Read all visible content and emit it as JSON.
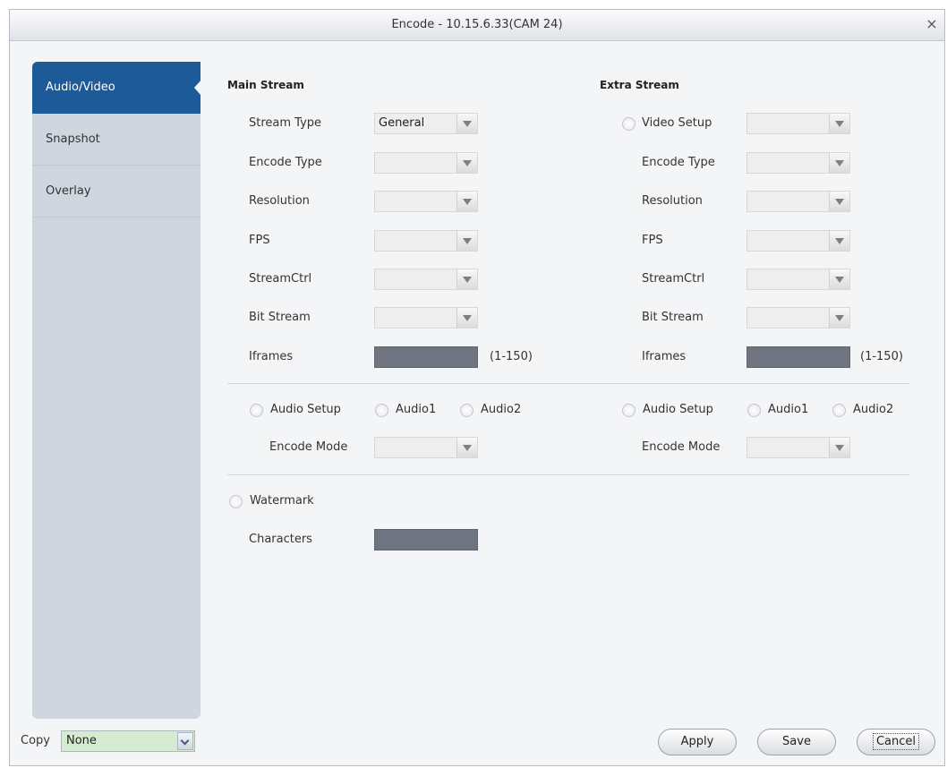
{
  "window": {
    "title": "Encode - 10.15.6.33(CAM 24)",
    "close_label": "×"
  },
  "sidebar": {
    "items": [
      {
        "label": "Audio/Video"
      },
      {
        "label": "Snapshot"
      },
      {
        "label": "Overlay"
      }
    ]
  },
  "main_stream": {
    "title": "Main Stream",
    "stream_type": {
      "label": "Stream Type",
      "value": "General"
    },
    "encode_type": {
      "label": "Encode Type",
      "value": ""
    },
    "resolution": {
      "label": "Resolution",
      "value": ""
    },
    "fps": {
      "label": "FPS",
      "value": ""
    },
    "stream_ctrl": {
      "label": "StreamCtrl",
      "value": ""
    },
    "bit_stream": {
      "label": "Bit Stream",
      "value": ""
    },
    "iframes": {
      "label": "Iframes",
      "range": "(1-150)"
    },
    "audio": {
      "setup": "Audio Setup",
      "audio1": "Audio1",
      "audio2": "Audio2",
      "encode_mode": {
        "label": "Encode Mode",
        "value": ""
      }
    }
  },
  "extra_stream": {
    "title": "Extra Stream",
    "video_setup": {
      "label": "Video Setup",
      "value": ""
    },
    "encode_type": {
      "label": "Encode Type",
      "value": ""
    },
    "resolution": {
      "label": "Resolution",
      "value": ""
    },
    "fps": {
      "label": "FPS",
      "value": ""
    },
    "stream_ctrl": {
      "label": "StreamCtrl",
      "value": ""
    },
    "bit_stream": {
      "label": "Bit Stream",
      "value": ""
    },
    "iframes": {
      "label": "Iframes",
      "range": "(1-150)"
    },
    "audio": {
      "setup": "Audio Setup",
      "audio1": "Audio1",
      "audio2": "Audio2",
      "encode_mode": {
        "label": "Encode Mode",
        "value": ""
      }
    }
  },
  "watermark": {
    "label": "Watermark",
    "characters_label": "Characters"
  },
  "copy": {
    "label": "Copy",
    "value": "None"
  },
  "buttons": {
    "apply": "Apply",
    "save": "Save",
    "cancel": "Cancel"
  },
  "colors": {
    "sidebar_active": "#1d5a98",
    "sidebar_bg": "#d0d6e0",
    "input_dark": "#6e7580",
    "copy_bg": "#d6ecd0"
  }
}
